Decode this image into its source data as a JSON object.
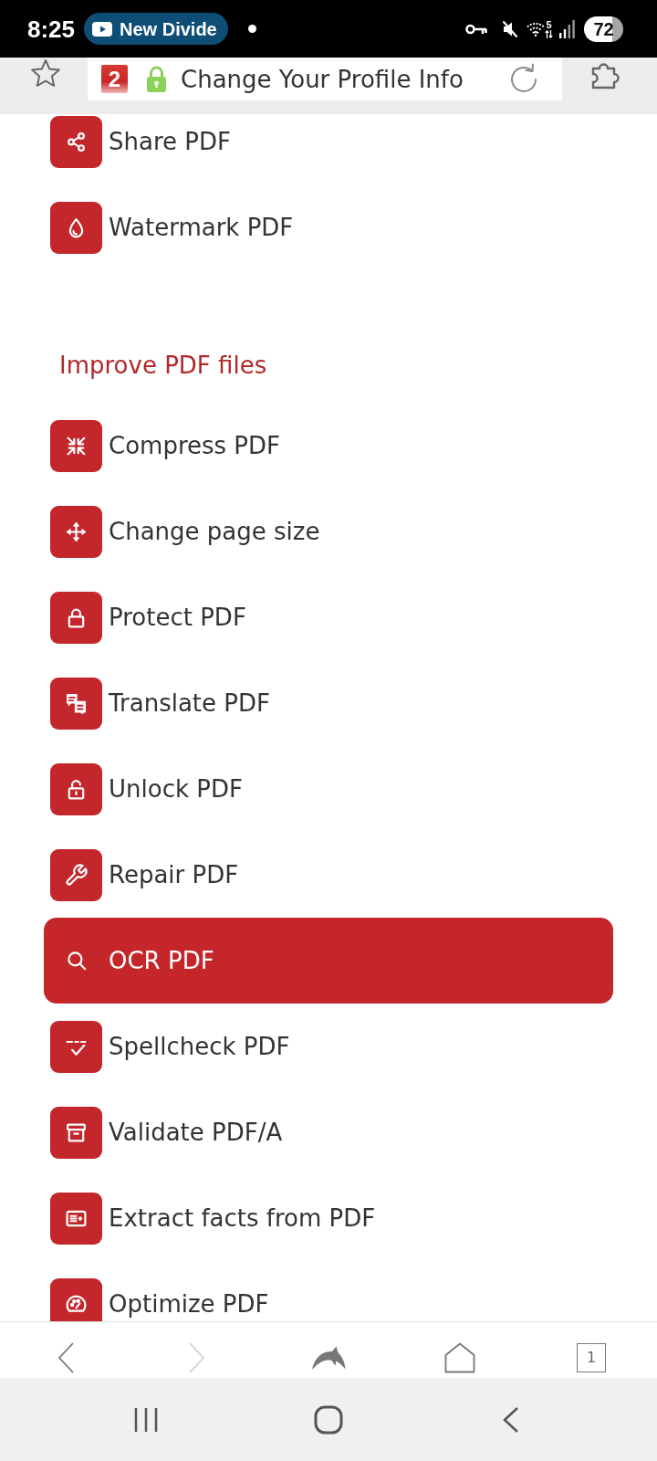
{
  "status_bar": {
    "time": "8:25",
    "media_chip": "New Divide",
    "wifi_band": "5",
    "battery": "72"
  },
  "browser_bar": {
    "site_badge": "2",
    "page_title": "Change Your Profile Info"
  },
  "menu_sections": [
    {
      "items": [
        {
          "label": "Share PDF",
          "selected": false
        },
        {
          "label": "Watermark PDF",
          "selected": false
        }
      ]
    },
    {
      "title": "Improve PDF files",
      "items": [
        {
          "label": "Compress PDF",
          "selected": false
        },
        {
          "label": "Change page size",
          "selected": false
        },
        {
          "label": "Protect PDF",
          "selected": false
        },
        {
          "label": "Translate PDF",
          "selected": false
        },
        {
          "label": "Unlock PDF",
          "selected": false
        },
        {
          "label": "Repair PDF",
          "selected": false
        },
        {
          "label": "OCR PDF",
          "selected": true
        },
        {
          "label": "Spellcheck PDF",
          "selected": false
        },
        {
          "label": "Validate PDF/A",
          "selected": false
        },
        {
          "label": "Extract facts from PDF",
          "selected": false
        },
        {
          "label": "Optimize PDF",
          "selected": false
        }
      ]
    }
  ],
  "bottom_toolbar": {
    "back": {
      "disabled": false
    },
    "forward": {
      "disabled": true
    },
    "tab_count": "1"
  }
}
